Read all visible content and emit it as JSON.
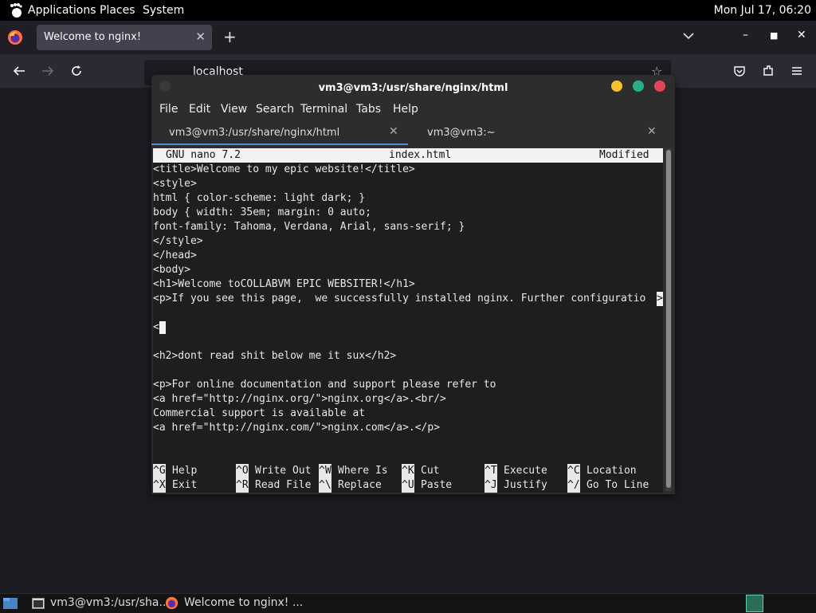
{
  "topbar": {
    "menus": [
      "Applications",
      "Places",
      "System"
    ],
    "clock": "Mon Jul 17, 06:20"
  },
  "browser": {
    "tab_title": "Welcome to nginx!",
    "url": "localhost",
    "accent": "#0061e0"
  },
  "terminal": {
    "title": "vm3@vm3:/usr/share/nginx/html",
    "menus": [
      "File",
      "Edit",
      "View",
      "Search",
      "Terminal",
      "Tabs",
      "Help"
    ],
    "tabs": [
      {
        "label": "vm3@vm3:/usr/share/nginx/html",
        "active": true
      },
      {
        "label": "vm3@vm3:~",
        "active": false
      }
    ],
    "buttons": {
      "minimize_color": "#f5c12e",
      "maximize_color": "#26b08a",
      "close_color": "#e0475b"
    }
  },
  "nano": {
    "header": {
      "app": "GNU nano 7.2",
      "file": "index.html",
      "status": "Modified"
    },
    "lines": [
      "<title>Welcome to my epic website!</title>",
      "<style>",
      "html { color-scheme: light dark; }",
      "body { width: 35em; margin: 0 auto;",
      "font-family: Tahoma, Verdana, Arial, sans-serif; }",
      "</style>",
      "</head>",
      "<body>",
      "<h1>Welcome toCOLLABVM EPIC WEBSITER!</h1>",
      "<p>If you see this page,  we successfully installed nginx. Further configuratio",
      "",
      "<",
      "",
      "<h2>dont read shit below me it sux</h2>",
      "",
      "<p>For online documentation and support please refer to",
      "<a href=\"http://nginx.org/\">nginx.org</a>.<br/>",
      "Commercial support is available at",
      "<a href=\"http://nginx.com/\">nginx.com</a>.</p>"
    ],
    "overflow_marker": ">",
    "shortcuts_row1": [
      {
        "key": "^G",
        "label": "Help"
      },
      {
        "key": "^O",
        "label": "Write Out"
      },
      {
        "key": "^W",
        "label": "Where Is"
      },
      {
        "key": "^K",
        "label": "Cut"
      },
      {
        "key": "^T",
        "label": "Execute"
      },
      {
        "key": "^C",
        "label": "Location"
      }
    ],
    "shortcuts_row2": [
      {
        "key": "^X",
        "label": "Exit"
      },
      {
        "key": "^R",
        "label": "Read File"
      },
      {
        "key": "^\\",
        "label": "Replace"
      },
      {
        "key": "^U",
        "label": "Paste"
      },
      {
        "key": "^J",
        "label": "Justify"
      },
      {
        "key": "^/",
        "label": "Go To Line"
      }
    ]
  },
  "taskbar": {
    "items": [
      "vm3@vm3:/usr/sha...",
      "Welcome to nginx! ..."
    ]
  }
}
